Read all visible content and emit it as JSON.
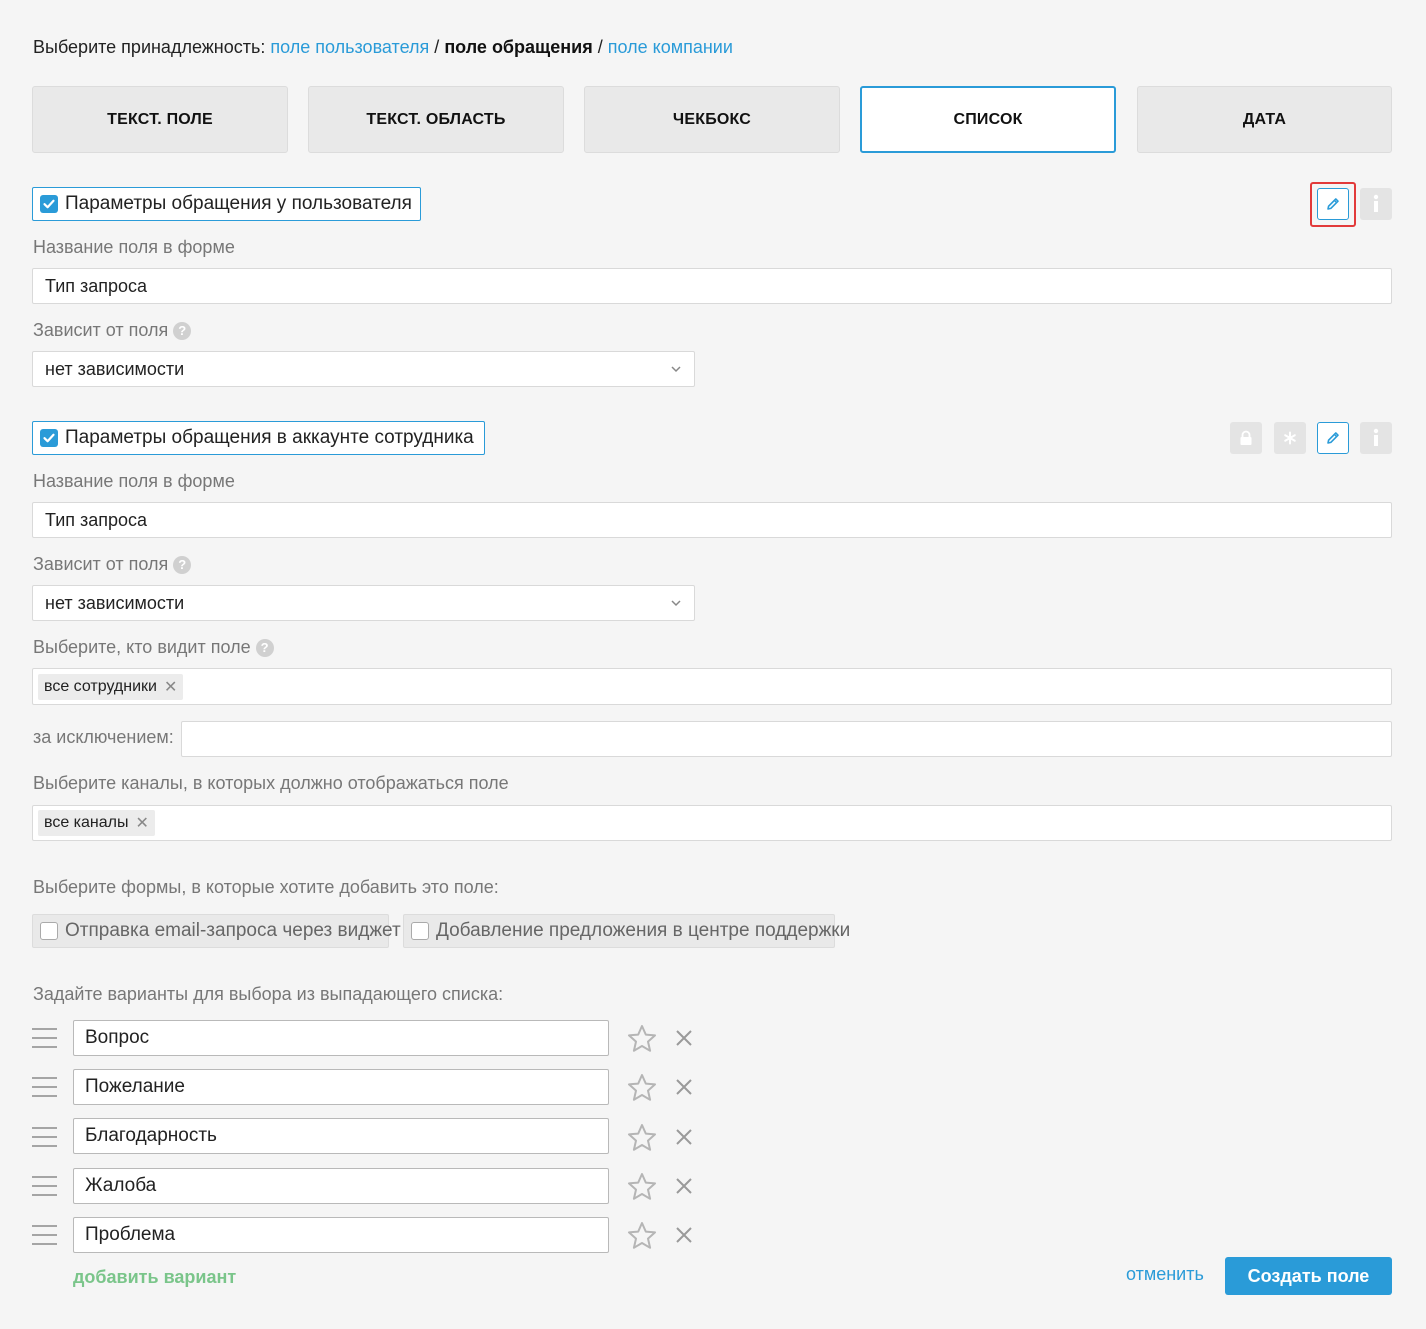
{
  "ownership": {
    "prefix": "Выберите принадлежность:",
    "user_field": "поле пользователя",
    "separator": "/",
    "ticket_field": "поле обращения",
    "company_field": "поле компании"
  },
  "field_types": [
    {
      "label": "ТЕКСТ. ПОЛЕ"
    },
    {
      "label": "ТЕКСТ. ОБЛАСТЬ"
    },
    {
      "label": "ЧЕКБОКС"
    },
    {
      "label": "СПИСОК",
      "active": true
    },
    {
      "label": "ДАТА"
    }
  ],
  "user_section": {
    "title": "Параметры обращения у пользователя",
    "checked": true,
    "name_label": "Название поля в форме",
    "name_value": "Тип запроса",
    "depends_label": "Зависит от поля",
    "depends_value": "нет зависимости"
  },
  "agent_section": {
    "title": "Параметры обращения в аккаунте сотрудника",
    "checked": true,
    "name_label": "Название поля в форме",
    "name_value": "Тип запроса",
    "depends_label": "Зависит от поля",
    "depends_value": "нет зависимости",
    "visibility_label": "Выберите, кто видит поле",
    "visibility_tag": "все сотрудники",
    "except_label": "за исключением:",
    "except_value": "",
    "channels_label": "Выберите каналы, в которых должно отображаться поле",
    "channels_tag": "все каналы"
  },
  "forms": {
    "label": "Выберите формы, в которые хотите добавить это поле:",
    "options": [
      {
        "label": "Отправка email-запроса через виджет",
        "checked": false
      },
      {
        "label": "Добавление предложения в центре поддержки",
        "checked": false
      }
    ]
  },
  "variants": {
    "label": "Задайте варианты для выбора из выпадающего списка:",
    "items": [
      "Вопрос",
      "Пожелание",
      "Благодарность",
      "Жалоба",
      "Проблема"
    ],
    "add_label": "добавить вариант"
  },
  "actions": {
    "cancel": "отменить",
    "create": "Создать поле"
  },
  "icons": {
    "edit": "pencil-icon",
    "info": "info-icon",
    "lock": "lock-icon",
    "required": "asterisk-icon",
    "help": "question-icon",
    "drag": "drag-handle-icon",
    "default": "star-icon",
    "remove": "close-icon"
  },
  "colors": {
    "accent": "#2a9bd8",
    "highlight": "#e23a3a",
    "add_link": "#7ac58a"
  }
}
